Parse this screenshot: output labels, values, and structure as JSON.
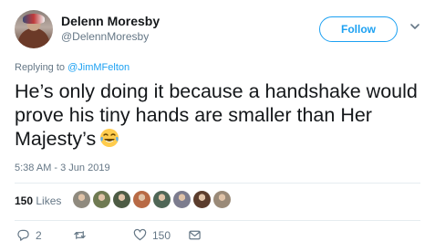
{
  "author": {
    "display_name": "Delenn Moresby",
    "handle": "@DelennMoresby"
  },
  "follow_button_label": "Follow",
  "replying": {
    "prefix": "Replying to",
    "mention": "@JimMFelton"
  },
  "tweet": {
    "text": "He’s only doing it because a handshake would prove his tiny hands are smaller than Her Majesty’s",
    "emoji": "face-with-tears-of-joy",
    "timestamp": "5:38 AM - 3 Jun 2019"
  },
  "engagement": {
    "likes_count": "150",
    "likes_label": "Likes",
    "liker_avatars": [
      "#8f8a7e",
      "#6f7a52",
      "#4d5b44",
      "#b86a45",
      "#4f6656",
      "#7c7c8e",
      "#5b3d2d",
      "#9a8a78"
    ]
  },
  "actions": {
    "reply_count": "2",
    "retweet_count": "",
    "like_count": "150"
  },
  "colors": {
    "brand_blue": "#1da1f2",
    "muted_text": "#657786"
  }
}
